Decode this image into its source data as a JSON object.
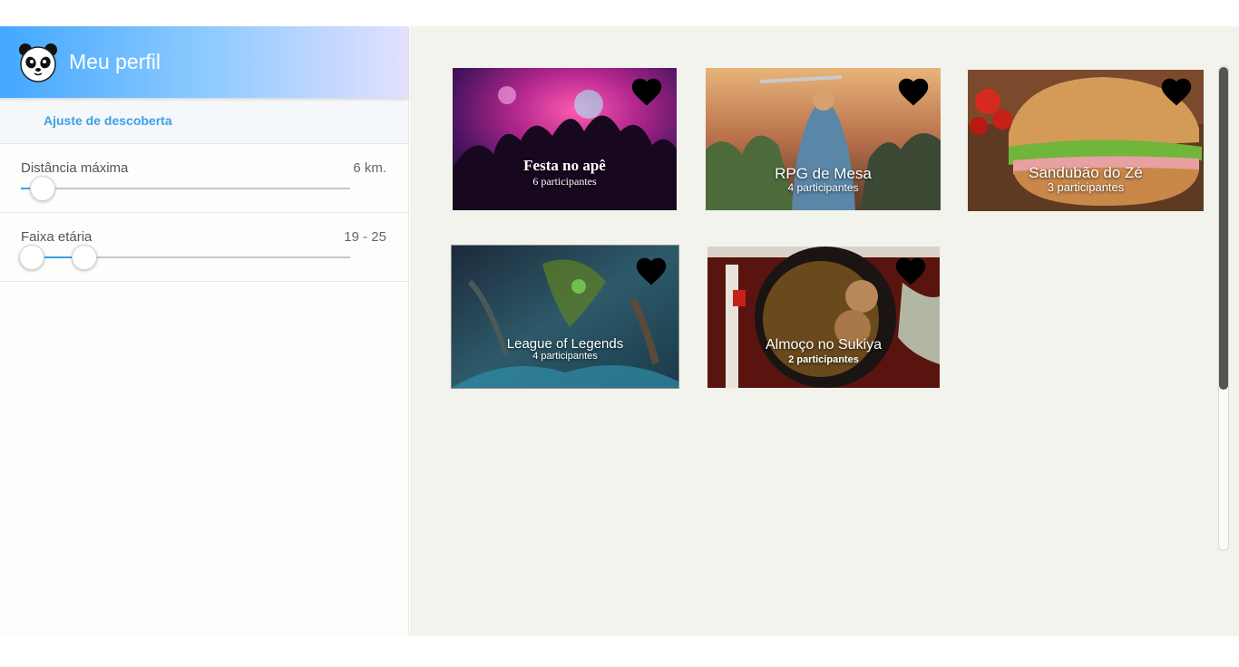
{
  "profile": {
    "title": "Meu perfil"
  },
  "discovery": {
    "label": "Ajuste de descoberta"
  },
  "settings": {
    "distance": {
      "label": "Distância máxima",
      "value": "6 km.",
      "level": 0.05
    },
    "age": {
      "label": "Faixa etária",
      "value": "19 - 25",
      "low": 0.03,
      "high": 0.19
    }
  },
  "cards": [
    {
      "title": "Festa no apê",
      "participants": "6 participantes"
    },
    {
      "title": "RPG de Mesa",
      "participants": "4 participantes"
    },
    {
      "title": "Sandubão do Zé",
      "participants": "3 participantes"
    },
    {
      "title": "League of Legends",
      "participants": "4 participantes"
    },
    {
      "title": "Almoço no Sukiya",
      "participants": "2 participantes"
    }
  ],
  "colors": {
    "accent": "#3aa0e8",
    "main_bg": "#f3f3ed"
  }
}
